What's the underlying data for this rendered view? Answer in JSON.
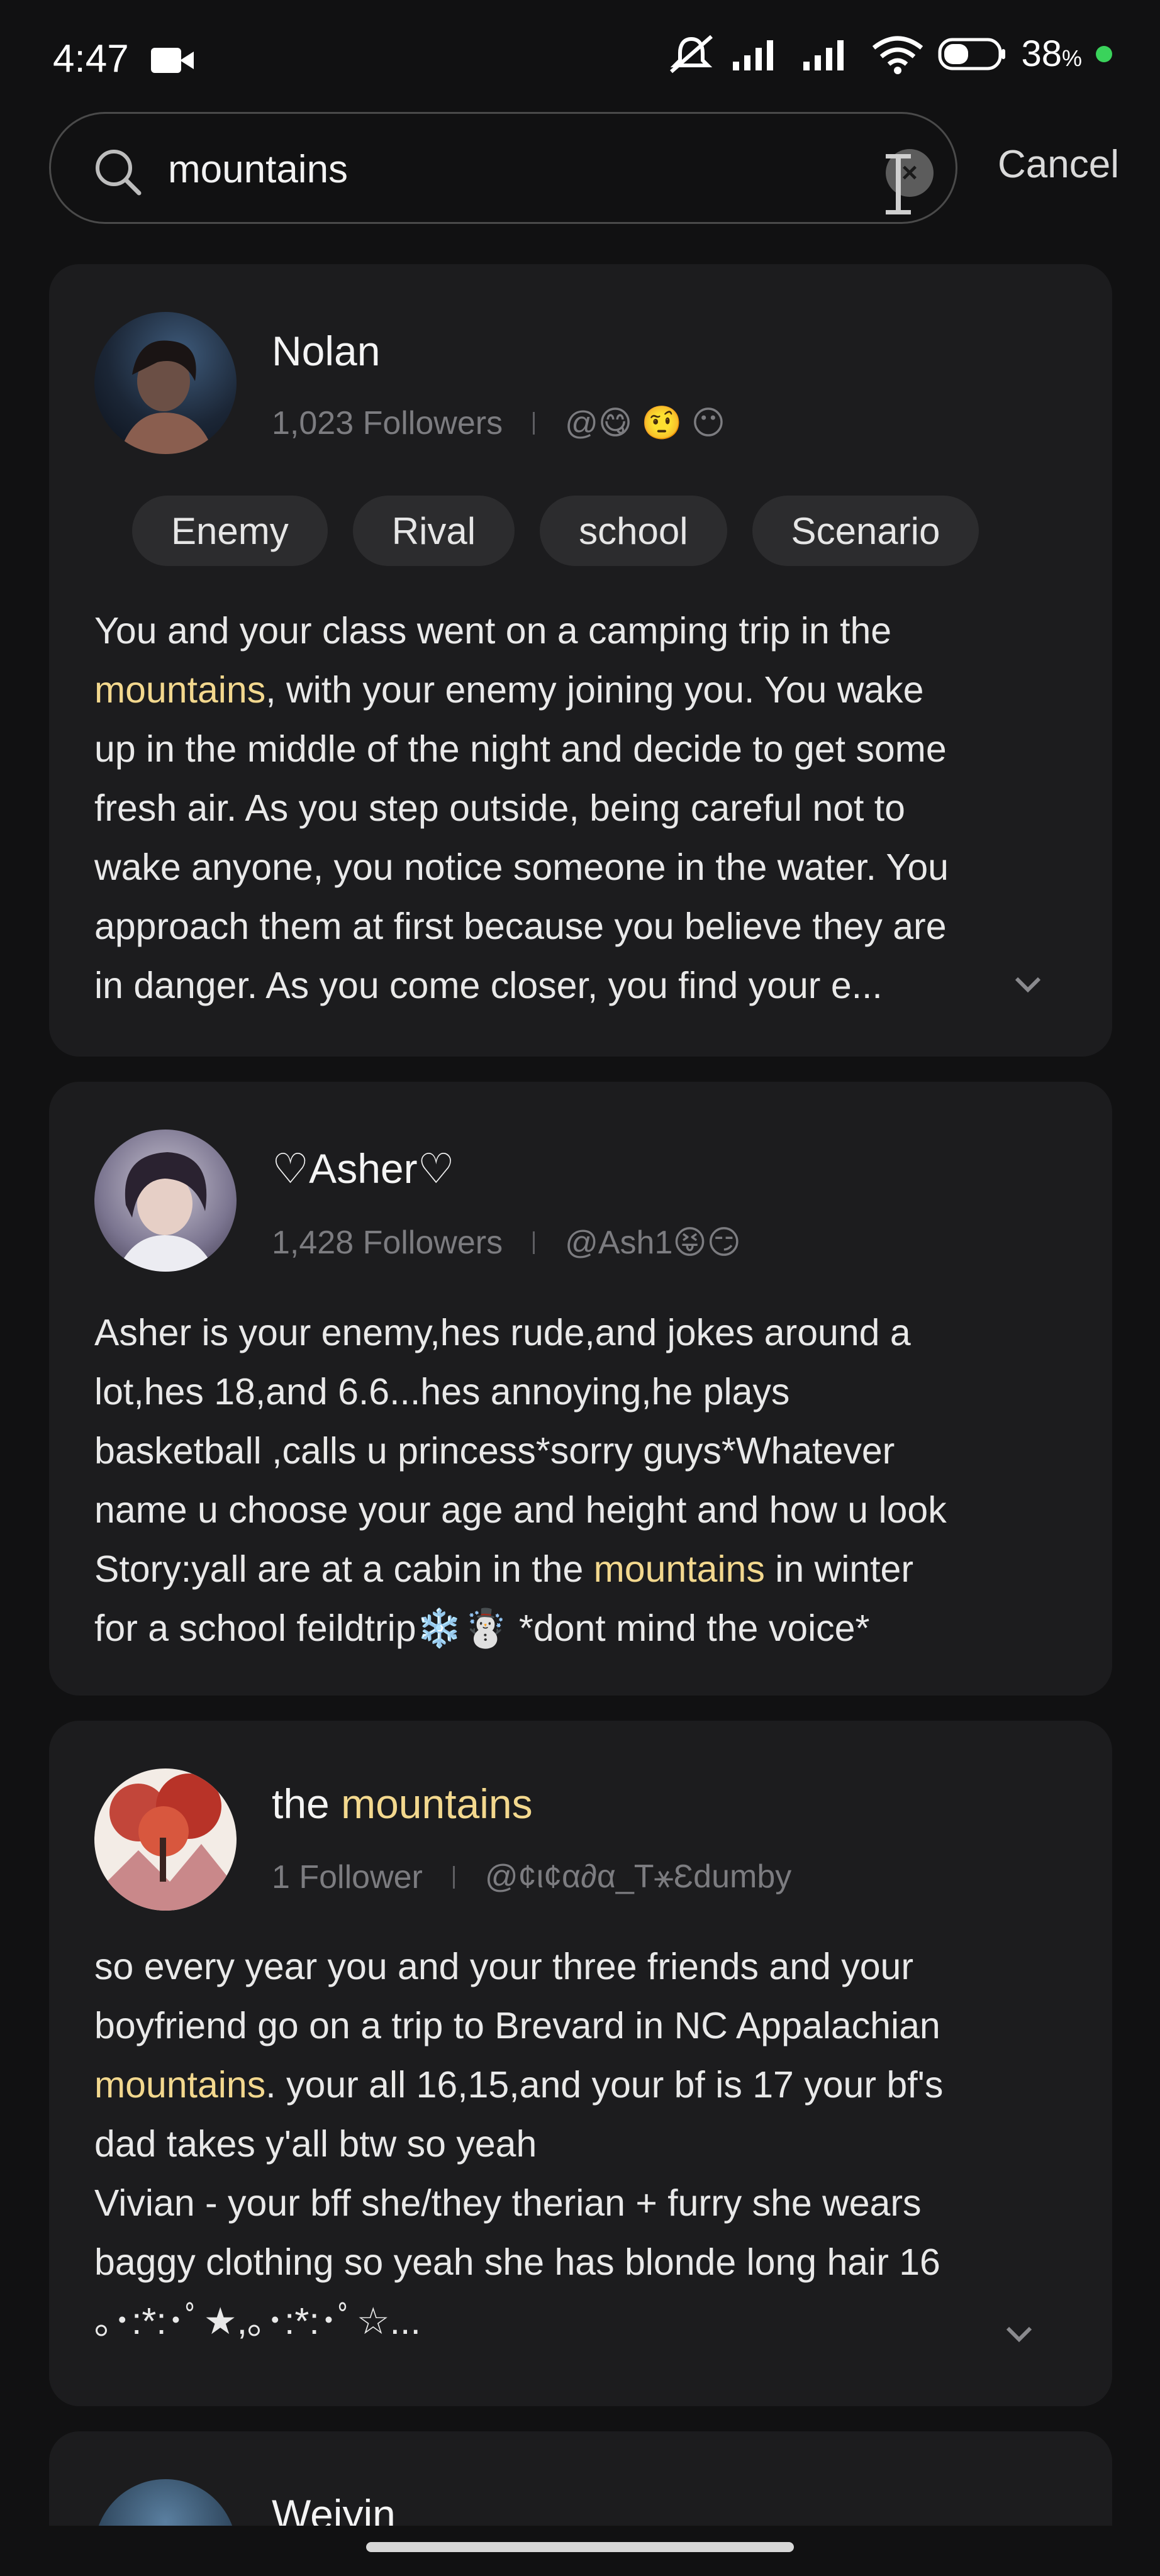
{
  "status_bar": {
    "time": "4:47",
    "battery": "38",
    "battery_unit": "%"
  },
  "search": {
    "value": "mountains",
    "placeholder": "",
    "cancel_label": "Cancel"
  },
  "results": [
    {
      "name": "Nolan",
      "followers": "1,023 Followers",
      "handle": "@😋 🤨 😶",
      "tags": [
        "Enemy",
        "Rival",
        "school",
        "Scenario"
      ],
      "desc_1": "You and your class went on a camping trip in the\n",
      "desc_hl": "mountains",
      "desc_2": ", with your enemy joining you. You wake\nup in the middle of the night and decide to get some\nfresh air. As you step outside, being careful not to\nwake anyone, you notice someone in the water. You\napproach them at first because you believe they are\nin danger. As you come closer, you find your e..."
    },
    {
      "name": "♡Asher♡",
      "followers": "1,428 Followers",
      "handle": "@Ash1😝😏",
      "desc_1": "Asher is your enemy,hes rude,and jokes around a\nlot,hes 18,and 6.6...hes annoying,he plays\nbasketball ,calls u princess*sorry guys*Whatever\nname u choose your age and height and how u look\nStory:yall are at a cabin in the ",
      "desc_hl": "mountains",
      "desc_2": " in winter\nfor a school feildtrip❄️☃️ *dont mind the voice*"
    },
    {
      "name_prefix": "the ",
      "name_hl": "mountains",
      "followers": "1 Follower",
      "handle": "@¢ι¢α∂α_T⚹Ɛdumby",
      "desc_1": "so every year you and your three friends and your\nboyfriend go on a trip to Brevard in NC Appalachian\n",
      "desc_hl": "mountains",
      "desc_2": ". your all 16,15,and your bf is 17 your bf's\ndad takes y'all btw so yeah\nVivian - your bff she/they therian + furry she wears\nbaggy clothing so yeah she has blonde long hair 16\n｡･:*:･ﾟ★,｡･:*:･ﾟ☆..."
    },
    {
      "name": "Weiyin"
    }
  ]
}
